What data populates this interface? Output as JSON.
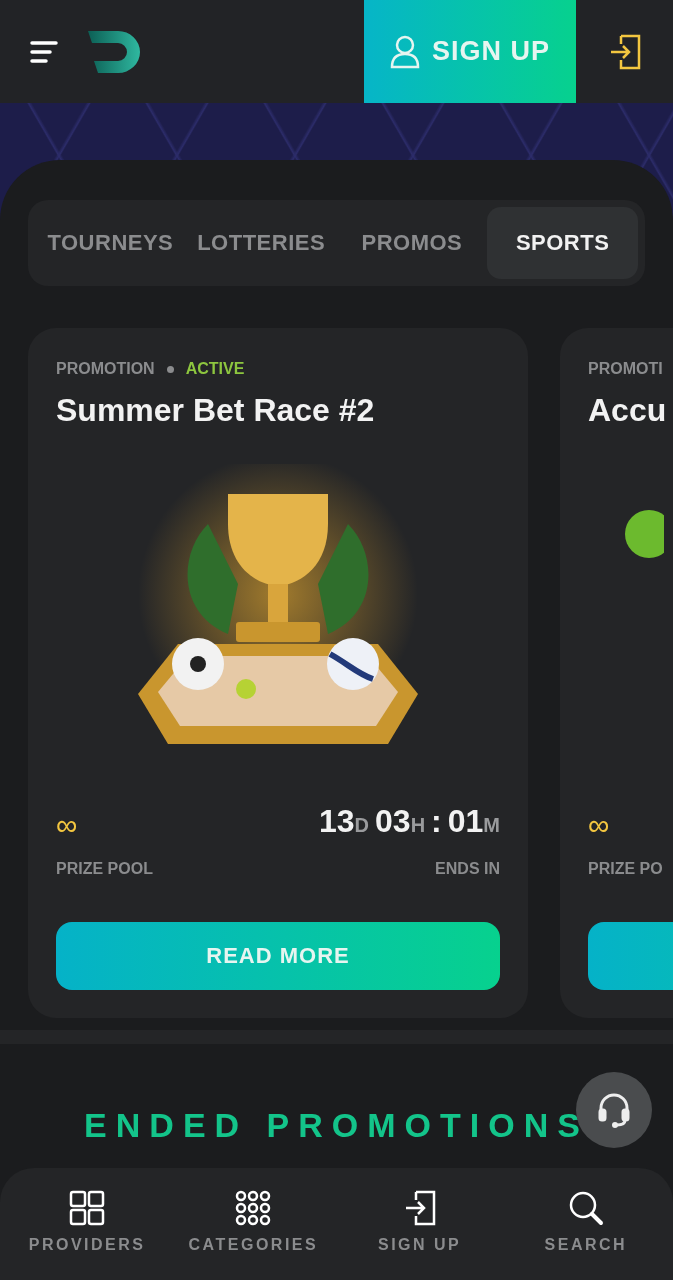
{
  "header": {
    "sign_up": "SIGN UP"
  },
  "tabs": [
    {
      "label": "TOURNEYS",
      "selected": false
    },
    {
      "label": "LOTTERIES",
      "selected": false
    },
    {
      "label": "PROMOS",
      "selected": false
    },
    {
      "label": "SPORTS",
      "selected": true
    }
  ],
  "promotions": [
    {
      "category": "PROMOTION",
      "status": "ACTIVE",
      "title": "Summer Bet Race #2",
      "prize": "∞",
      "prize_label": "PRIZE POOL",
      "countdown": [
        {
          "value": "13",
          "unit": "D"
        },
        {
          "value": "03",
          "unit": "H"
        },
        {
          "value": ":"
        },
        {
          "value": "01",
          "unit": "M"
        }
      ],
      "ends_label": "ENDS IN",
      "button": "READ MORE"
    },
    {
      "category": "PROMOTI",
      "title": "Accu",
      "prize": "∞",
      "prize_label": "PRIZE PO"
    }
  ],
  "section_title": "ENDED PROMOTIONS",
  "bottom_nav": [
    {
      "kind": "grid",
      "label": "PROVIDERS"
    },
    {
      "kind": "dots",
      "label": "CATEGORIES"
    },
    {
      "kind": "signin",
      "label": "SIGN UP"
    },
    {
      "kind": "search",
      "label": "SEARCH"
    }
  ]
}
